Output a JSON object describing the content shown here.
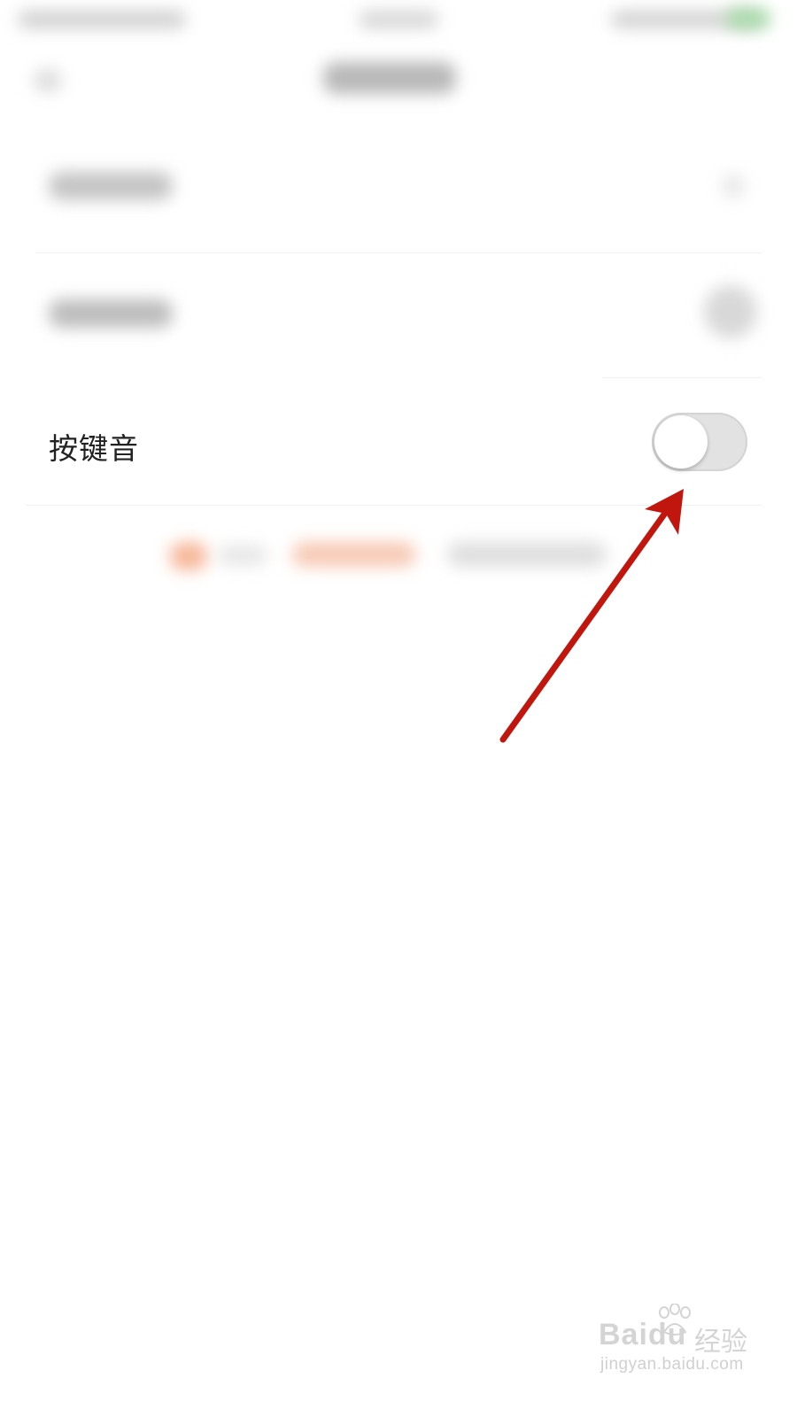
{
  "settings": {
    "key_sound": {
      "label": "按键音",
      "enabled": false
    }
  },
  "colors": {
    "annotation_arrow": "#c0160e",
    "toggle_off_track": "#e2e2e2",
    "label_text": "#222222"
  },
  "icons": {
    "annotation": "arrow-pointer",
    "watermark_logo": "paw-icon"
  },
  "watermark": {
    "brand": "Baidu",
    "product": "经验",
    "url": "jingyan.baidu.com"
  }
}
